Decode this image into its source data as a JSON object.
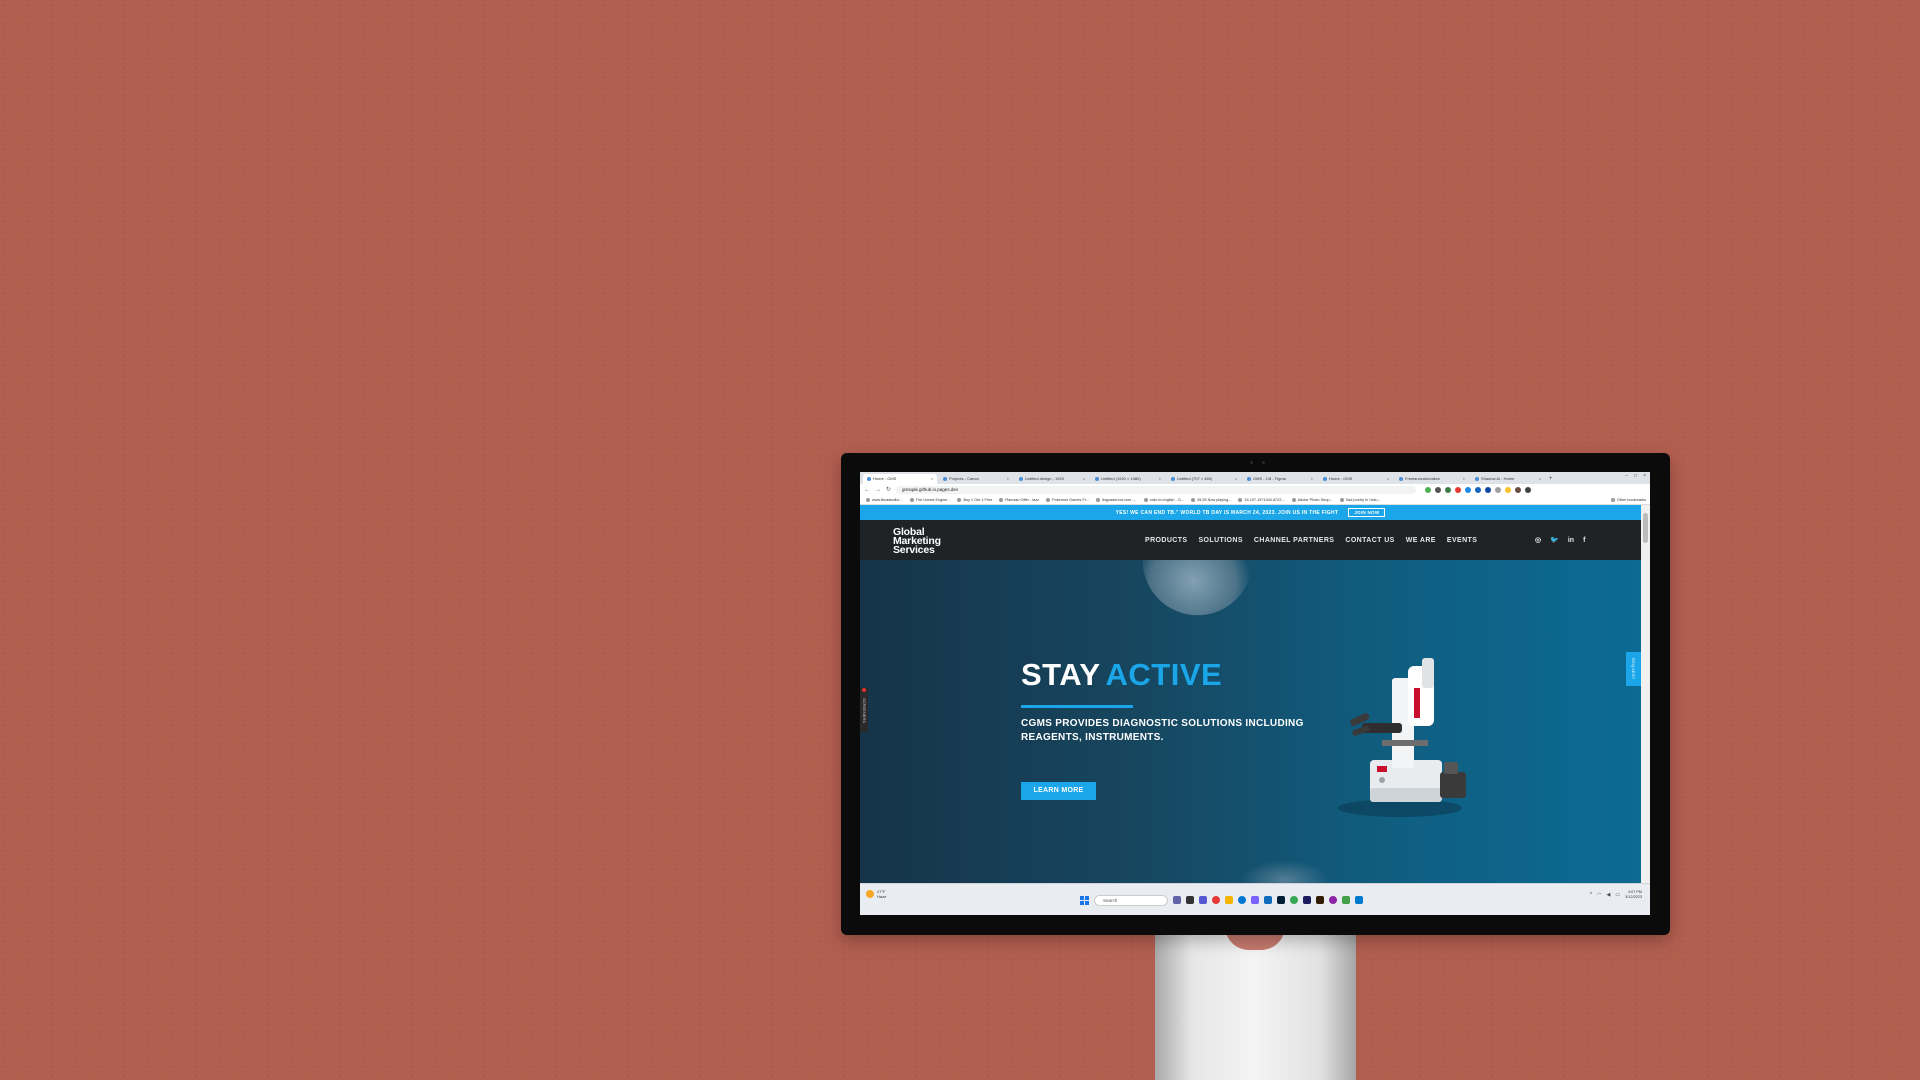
{
  "browser": {
    "tabs": [
      {
        "label": "Home - GMS",
        "active": true
      },
      {
        "label": "Projects - Canva",
        "active": false
      },
      {
        "label": "Untitled design - 1920",
        "active": false
      },
      {
        "label": "Untitled (1920 × 1080)",
        "active": false
      },
      {
        "label": "Untitled (707 × 480)",
        "active": false
      },
      {
        "label": "GMS - 1/8 - Figma",
        "active": false
      },
      {
        "label": "Home - GMS",
        "active": false
      },
      {
        "label": "Freelanceuk/makes",
        "active": false
      },
      {
        "label": "Shadow AI - Home",
        "active": false
      }
    ],
    "new_tab": "+",
    "url": "gmsqak.github.io.pages.dev",
    "bookmarks": [
      "www.fbcastudio/...",
      "The Unreal Engine...",
      "Buy 1 Get 1 Free",
      "Ramzan Offer - lazz",
      "Pokemon Games Fr...",
      "linguaderoot.com -...",
      "urdu to english - G...",
      "26:28 Now playing...",
      "15.157.1571340.8722...",
      "Adobe Photo Shop...",
      "Sad poetry In Urdu..."
    ],
    "other_bookmarks": "Other bookmarks"
  },
  "site": {
    "announcement": "YES! WE CAN END TB.\" WORLD TB DAY IS MARCH 24, 2023. JOIN US IN THE FIGHT",
    "join_label": "JOIN NOW",
    "logo_lines": [
      "Global",
      "Marketing",
      "Services"
    ],
    "menu": [
      "PRODUCTS",
      "SOLUTIONS",
      "CHANNEL PARTNERS",
      "CONTACT US",
      "WE ARE",
      "EVENTS"
    ],
    "social": [
      "instagram-icon",
      "twitter-icon",
      "linkedin-icon",
      "facebook-icon"
    ],
    "hero": {
      "title_word1": "STAY",
      "title_word2": "ACTIVE",
      "subtitle": "CGMS PROVIDES DIAGNOSTIC SOLUTIONS INCLUDING REAGENTS, INSTRUMENTS.",
      "cta": "LEARN MORE"
    },
    "side_tab": "SCREENERS",
    "request_tab": "REQUEST"
  },
  "taskbar": {
    "weather_temp": "27°F",
    "weather_desc": "Haze",
    "search_placeholder": "Search",
    "time": "4:07 PM",
    "date": "3/12/2023"
  },
  "colors": {
    "background": "#b25e4f",
    "accent": "#1aa6e8",
    "navbar": "#202326"
  }
}
